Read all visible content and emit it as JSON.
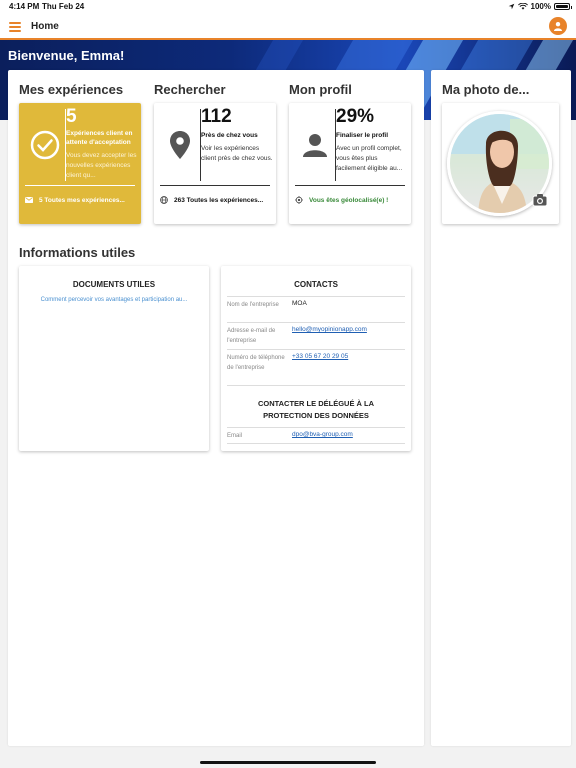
{
  "status_bar": {
    "time": "4:14 PM",
    "date": "Thu Feb 24",
    "battery": "100%"
  },
  "nav": {
    "title": "Home"
  },
  "banner": {
    "welcome": "Bienvenue, Emma!"
  },
  "sections": {
    "experiences": "Mes expériences",
    "search": "Rechercher",
    "profile": "Mon profil",
    "photo": "Ma photo de...",
    "info": "Informations utiles"
  },
  "cards": {
    "experiences": {
      "number": "5",
      "subtitle": "Expériences client en attente d'acceptation",
      "desc": "Vous devez accepter les nouvelles expériences client qu...",
      "footer": "5 Toutes mes expériences..."
    },
    "search": {
      "number": "112",
      "subtitle": "Près de chez vous",
      "desc": "Voir les expériences client près de chez vous.",
      "footer": "263 Toutes les expériences..."
    },
    "profile": {
      "number": "29%",
      "subtitle": "Finaliser le profil",
      "desc": "Avec un profil complet, vous êtes plus facilement éligible au...",
      "footer": "Vous êtes géolocalisé(e) !"
    }
  },
  "documents": {
    "heading": "DOCUMENTS UTILES",
    "link": "Comment percevoir vos avantages et participation au..."
  },
  "contacts": {
    "heading": "CONTACTS",
    "rows": [
      {
        "label": "Nom de l'entreprise",
        "value": "MOA"
      },
      {
        "label": "Adresse e-mail de l'entreprise",
        "value": "hello@myopinionapp.com"
      },
      {
        "label": "Numéro de téléphone de l'entreprise",
        "value": "+33 05 67 20 29 05"
      }
    ],
    "dpo_heading": "CONTACTER LE DÉLÉGUÉ À LA PROTECTION DES DONNÉES",
    "dpo_row": {
      "label": "Email",
      "value": "dpo@bva-group.com"
    }
  },
  "colors": {
    "accent": "#e8832a",
    "card_yellow": "#e0b93a",
    "link": "#1f5fb3",
    "geo_green": "#3a8a3a"
  }
}
